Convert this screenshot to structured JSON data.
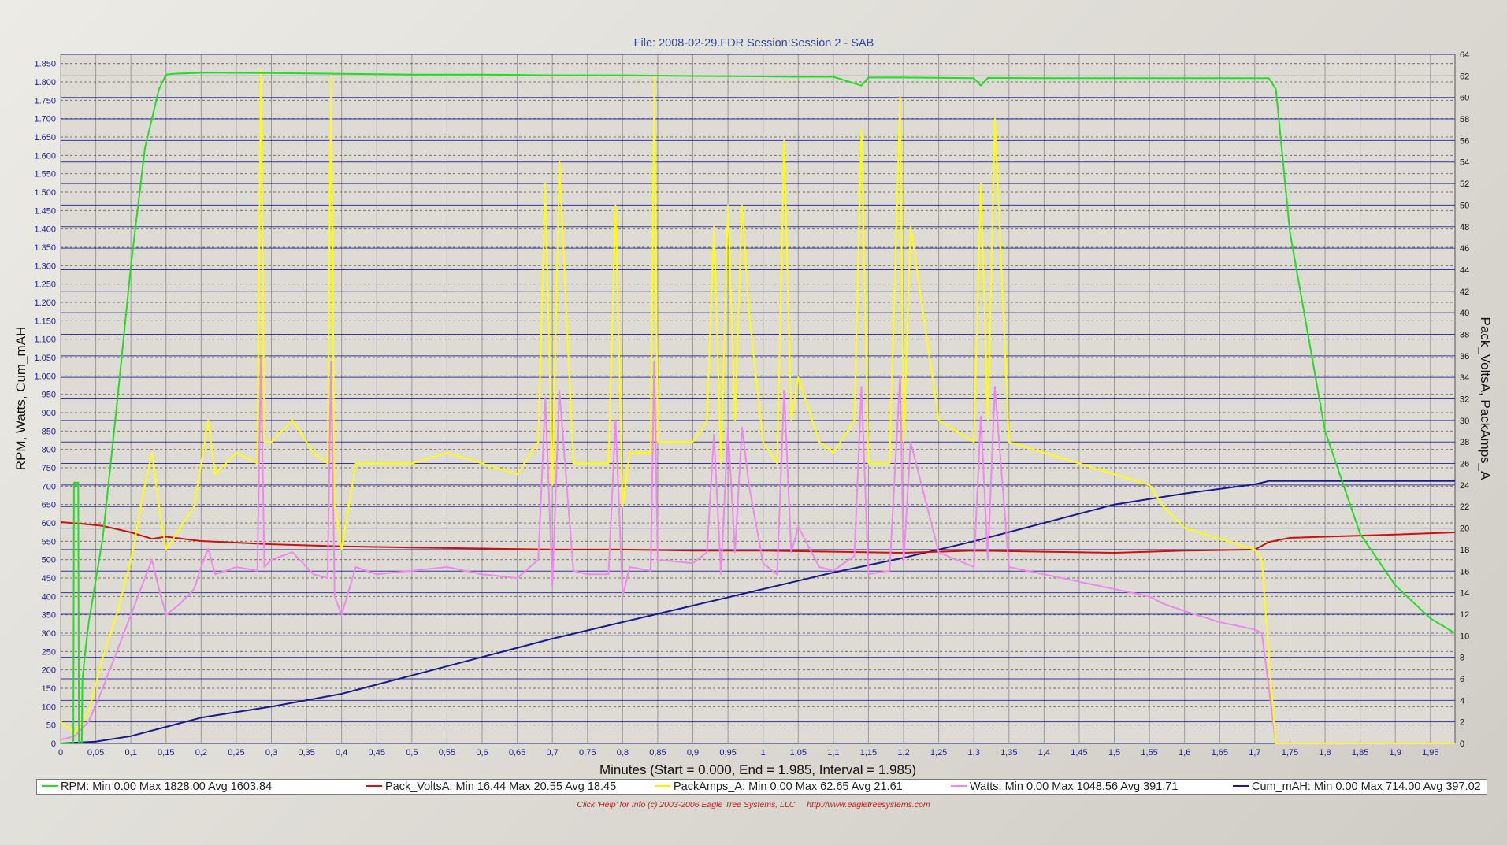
{
  "chart_data": {
    "type": "line",
    "title": "File: 2008-02-29.FDR   Session:Session 2 - SAB",
    "xlabel": "Minutes (Start = 0.000,  End = 1.985,  Interval =  1.985)",
    "ylabel": "RPM, Watts, Cum_mAH",
    "y2label": "Pack_VoltsA, PackAmps_A",
    "xlim": [
      0,
      1.985
    ],
    "ylim": [
      0,
      1875
    ],
    "y2lim": [
      0,
      64
    ],
    "grid": true,
    "x_ticks": [
      "0",
      "0,05",
      "0,1",
      "0,15",
      "0,2",
      "0,25",
      "0,3",
      "0,35",
      "0,4",
      "0,45",
      "0,5",
      "0,55",
      "0,6",
      "0,65",
      "0,7",
      "0,75",
      "0,8",
      "0,85",
      "0,9",
      "0,95",
      "1",
      "1,05",
      "1,1",
      "1,15",
      "1,2",
      "1,25",
      "1,3",
      "1,35",
      "1,4",
      "1,45",
      "1,5",
      "1,55",
      "1,6",
      "1,65",
      "1,7",
      "1,75",
      "1,8",
      "1,85",
      "1,9",
      "1,95"
    ],
    "y_ticks": [
      "0",
      "50",
      "100",
      "150",
      "200",
      "250",
      "300",
      "350",
      "400",
      "450",
      "500",
      "550",
      "600",
      "650",
      "700",
      "750",
      "800",
      "850",
      "900",
      "950",
      "1.000",
      "1.050",
      "1.100",
      "1.150",
      "1.200",
      "1.250",
      "1.300",
      "1.350",
      "1.400",
      "1.450",
      "1.500",
      "1.550",
      "1.600",
      "1.650",
      "1.700",
      "1.750",
      "1.800",
      "1.850"
    ],
    "y2_ticks": [
      "0",
      "2",
      "4",
      "6",
      "8",
      "10",
      "12",
      "14",
      "16",
      "18",
      "20",
      "22",
      "24",
      "26",
      "28",
      "30",
      "32",
      "34",
      "36",
      "38",
      "40",
      "42",
      "44",
      "46",
      "48",
      "50",
      "52",
      "54",
      "56",
      "58",
      "60",
      "62",
      "64"
    ],
    "series": [
      {
        "name": "RPM",
        "axis": "left",
        "color": "#22dd22",
        "x": [
          0,
          0.018,
          0.019,
          0.025,
          0.026,
          0.03,
          0.031,
          0.035,
          0.04,
          0.06,
          0.08,
          0.1,
          0.12,
          0.14,
          0.15,
          0.16,
          0.2,
          0.3,
          0.4,
          0.5,
          0.6,
          0.7,
          0.8,
          0.9,
          1.0,
          1.05,
          1.1,
          1.14,
          1.15,
          1.2,
          1.3,
          1.31,
          1.32,
          1.4,
          1.5,
          1.6,
          1.7,
          1.72,
          1.73,
          1.75,
          1.8,
          1.85,
          1.9,
          1.95,
          1.985
        ],
        "y": [
          0,
          0,
          710,
          710,
          0,
          0,
          170,
          250,
          330,
          560,
          920,
          1300,
          1620,
          1780,
          1820,
          1822,
          1825,
          1824,
          1822,
          1820,
          1820,
          1818,
          1818,
          1816,
          1815,
          1814,
          1814,
          1790,
          1812,
          1812,
          1810,
          1790,
          1811,
          1810,
          1810,
          1810,
          1810,
          1810,
          1780,
          1390,
          850,
          570,
          430,
          340,
          300
        ]
      },
      {
        "name": "Pack_VoltsA",
        "axis": "right",
        "color": "#cc1111",
        "x": [
          0,
          0.03,
          0.06,
          0.1,
          0.13,
          0.15,
          0.2,
          0.3,
          0.4,
          0.5,
          0.6,
          0.7,
          0.8,
          0.9,
          1.0,
          1.1,
          1.2,
          1.3,
          1.4,
          1.5,
          1.6,
          1.7,
          1.72,
          1.75,
          1.8,
          1.9,
          1.985
        ],
        "y": [
          20.55,
          20.4,
          20.2,
          19.6,
          19.0,
          19.2,
          18.8,
          18.5,
          18.3,
          18.2,
          18.1,
          18.0,
          18.0,
          17.9,
          17.9,
          17.8,
          17.7,
          17.9,
          17.8,
          17.7,
          17.9,
          18.0,
          18.7,
          19.1,
          19.2,
          19.4,
          19.6
        ]
      },
      {
        "name": "PackAmps_A",
        "axis": "right",
        "color": "#ffff00",
        "x": [
          0,
          0.02,
          0.04,
          0.06,
          0.08,
          0.1,
          0.12,
          0.13,
          0.14,
          0.15,
          0.17,
          0.19,
          0.2,
          0.21,
          0.22,
          0.25,
          0.28,
          0.285,
          0.29,
          0.3,
          0.33,
          0.36,
          0.38,
          0.385,
          0.39,
          0.4,
          0.42,
          0.45,
          0.5,
          0.55,
          0.6,
          0.65,
          0.68,
          0.69,
          0.7,
          0.71,
          0.73,
          0.75,
          0.78,
          0.79,
          0.8,
          0.81,
          0.84,
          0.845,
          0.85,
          0.9,
          0.92,
          0.93,
          0.94,
          0.95,
          0.96,
          0.97,
          0.98,
          1.0,
          1.02,
          1.03,
          1.04,
          1.05,
          1.08,
          1.1,
          1.13,
          1.14,
          1.15,
          1.18,
          1.195,
          1.2,
          1.21,
          1.25,
          1.3,
          1.31,
          1.32,
          1.33,
          1.35,
          1.4,
          1.45,
          1.5,
          1.55,
          1.57,
          1.6,
          1.65,
          1.7,
          1.71,
          1.72,
          1.73,
          1.75,
          1.8,
          1.85,
          1.9,
          1.95,
          1.985
        ],
        "y": [
          2,
          1,
          3,
          8,
          12,
          17,
          24,
          27,
          22,
          18,
          20,
          22,
          26,
          30,
          25,
          27,
          26,
          62.65,
          28,
          28,
          30,
          27,
          26,
          62,
          22,
          18,
          26,
          26,
          26,
          27,
          26,
          25,
          28,
          52,
          24,
          54,
          26,
          26,
          26,
          50,
          22,
          27,
          27,
          62,
          28,
          28,
          30,
          48,
          26,
          50,
          30,
          50,
          40,
          28,
          26,
          56,
          30,
          34,
          28,
          27,
          30,
          57,
          26,
          26,
          60,
          28,
          48,
          30,
          28,
          52,
          30,
          58,
          28,
          27,
          26,
          25,
          24,
          22,
          20,
          19,
          18,
          17,
          8,
          0,
          0,
          0,
          0,
          0,
          0,
          0
        ]
      },
      {
        "name": "Watts",
        "axis": "left",
        "color": "#ee88ee",
        "x": [
          0,
          0.02,
          0.04,
          0.06,
          0.08,
          0.1,
          0.12,
          0.13,
          0.14,
          0.15,
          0.17,
          0.19,
          0.2,
          0.21,
          0.22,
          0.25,
          0.28,
          0.285,
          0.29,
          0.3,
          0.33,
          0.36,
          0.38,
          0.385,
          0.39,
          0.4,
          0.42,
          0.45,
          0.5,
          0.55,
          0.6,
          0.65,
          0.68,
          0.69,
          0.7,
          0.71,
          0.73,
          0.75,
          0.78,
          0.79,
          0.8,
          0.81,
          0.84,
          0.845,
          0.85,
          0.9,
          0.92,
          0.93,
          0.94,
          0.95,
          0.96,
          0.97,
          0.98,
          1.0,
          1.02,
          1.03,
          1.04,
          1.05,
          1.08,
          1.1,
          1.13,
          1.14,
          1.15,
          1.18,
          1.195,
          1.2,
          1.21,
          1.25,
          1.3,
          1.31,
          1.32,
          1.33,
          1.35,
          1.4,
          1.45,
          1.5,
          1.55,
          1.57,
          1.6,
          1.65,
          1.7,
          1.71,
          1.72,
          1.73,
          1.75,
          1.8,
          1.85,
          1.9,
          1.95,
          1.985
        ],
        "y": [
          10,
          20,
          60,
          150,
          250,
          350,
          450,
          500,
          420,
          350,
          380,
          420,
          480,
          530,
          460,
          480,
          470,
          1048.56,
          480,
          500,
          520,
          460,
          450,
          1040,
          400,
          350,
          480,
          460,
          470,
          480,
          460,
          450,
          500,
          940,
          430,
          960,
          470,
          460,
          460,
          880,
          400,
          480,
          470,
          1040,
          500,
          490,
          520,
          840,
          460,
          860,
          520,
          860,
          700,
          490,
          460,
          960,
          520,
          590,
          480,
          470,
          510,
          970,
          460,
          470,
          1000,
          490,
          820,
          520,
          480,
          890,
          500,
          970,
          480,
          460,
          440,
          420,
          400,
          380,
          360,
          330,
          310,
          300,
          150,
          0,
          0,
          0,
          0,
          0,
          0,
          0
        ]
      },
      {
        "name": "Cum_mAH",
        "axis": "left",
        "color": "#1a1a8c",
        "x": [
          0,
          0.05,
          0.1,
          0.15,
          0.2,
          0.3,
          0.4,
          0.5,
          0.6,
          0.7,
          0.8,
          0.9,
          1.0,
          1.1,
          1.2,
          1.3,
          1.4,
          1.5,
          1.6,
          1.7,
          1.72,
          1.985
        ],
        "y": [
          0,
          5,
          20,
          45,
          70,
          100,
          135,
          185,
          235,
          285,
          330,
          375,
          420,
          465,
          505,
          550,
          600,
          650,
          680,
          705,
          714,
          714
        ]
      }
    ],
    "legend": [
      {
        "name": "RPM",
        "label": "RPM:  Min 0.00    Max 1828.00    Avg 1603.84",
        "color": "#22dd22"
      },
      {
        "name": "Pack_VoltsA",
        "label": "Pack_VoltsA:  Min 16.44    Max 20.55    Avg 18.45",
        "color": "#cc1111"
      },
      {
        "name": "PackAmps_A",
        "label": "PackAmps_A:  Min 0.00    Max 62.65    Avg 21.61",
        "color": "#ffee00"
      },
      {
        "name": "Watts",
        "label": "Watts:  Min 0.00    Max 1048.56    Avg 391.71",
        "color": "#ee88ee"
      },
      {
        "name": "Cum_mAH",
        "label": "Cum_mAH:  Min 0.00    Max 714.00    Avg 397.02",
        "color": "#1a1a8c"
      }
    ]
  },
  "footer": {
    "help": "Click 'Help' for Info  (c) 2003-2006 Eagle Tree Systems, LLC",
    "url": "http://www.eagletreesystems.com"
  },
  "colors": {
    "title": "#3344aa",
    "axis_text": "#1a1aa0",
    "grid_major": "#1a1a8c",
    "plot_bg": "#dedbd5"
  }
}
